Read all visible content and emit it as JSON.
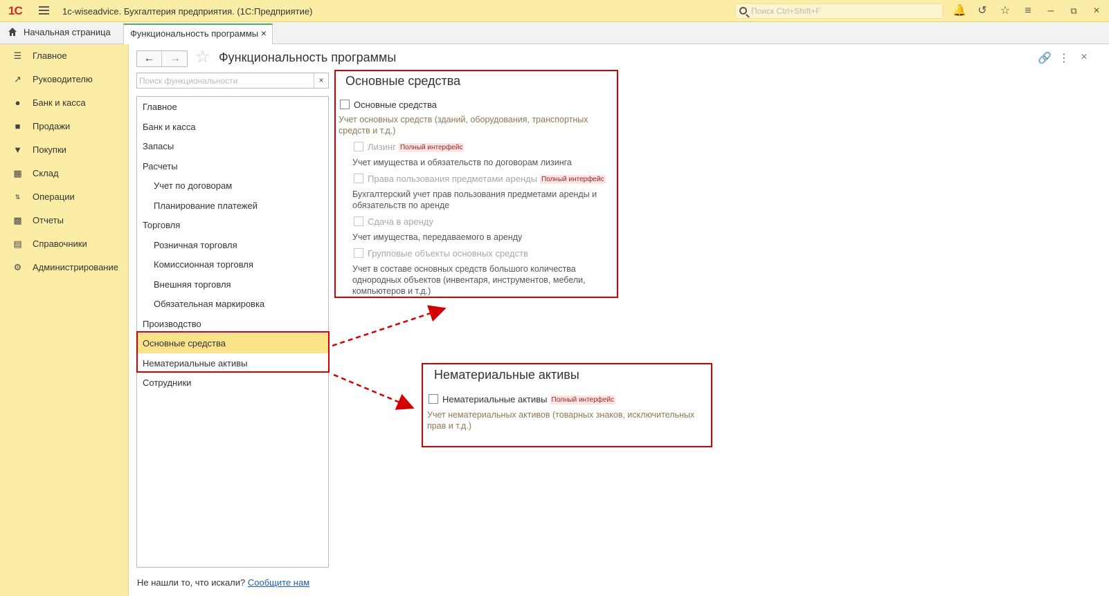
{
  "titlebar": {
    "app_title": "1c-wiseadvice. Бухгалтерия предприятия. (1С:Предприятие)",
    "search_placeholder": "Поиск Ctrl+Shift+F",
    "logo_text": "1С"
  },
  "tabs": {
    "home": "Начальная страница",
    "active": "Функциональность программы"
  },
  "sidebar": {
    "items": [
      {
        "label": "Главное",
        "icon": "list-icon"
      },
      {
        "label": "Руководителю",
        "icon": "trend-icon"
      },
      {
        "label": "Банк и касса",
        "icon": "coin-icon"
      },
      {
        "label": "Продажи",
        "icon": "bag-icon"
      },
      {
        "label": "Покупки",
        "icon": "cart-icon"
      },
      {
        "label": "Склад",
        "icon": "warehouse-icon"
      },
      {
        "label": "Операции",
        "icon": "operations-icon"
      },
      {
        "label": "Отчеты",
        "icon": "bar-chart-icon"
      },
      {
        "label": "Справочники",
        "icon": "book-icon"
      },
      {
        "label": "Администрирование",
        "icon": "gear-icon"
      }
    ]
  },
  "main": {
    "title": "Функциональность программы",
    "search_placeholder": "Поиск функциональности",
    "sections": [
      {
        "label": "Главное",
        "level": 0
      },
      {
        "label": "Банк и касса",
        "level": 0
      },
      {
        "label": "Запасы",
        "level": 0
      },
      {
        "label": "Расчеты",
        "level": 0
      },
      {
        "label": "Учет по договорам",
        "level": 1
      },
      {
        "label": "Планирование платежей",
        "level": 1
      },
      {
        "label": "Торговля",
        "level": 0
      },
      {
        "label": "Розничная торговля",
        "level": 1
      },
      {
        "label": "Комиссионная торговля",
        "level": 1
      },
      {
        "label": "Внешняя торговля",
        "level": 1
      },
      {
        "label": "Обязательная маркировка",
        "level": 1
      },
      {
        "label": "Производство",
        "level": 0
      },
      {
        "label": "Основные средства",
        "level": 0,
        "selected": true
      },
      {
        "label": "Нематериальные активы",
        "level": 0
      },
      {
        "label": "Сотрудники",
        "level": 0
      }
    ],
    "footer_text": "Не нашли то, что искали?",
    "footer_link": "Сообщите нам"
  },
  "fixed_assets_panel": {
    "title": "Основные средства",
    "main_checkbox": {
      "label": "Основные средства",
      "checked": false
    },
    "main_desc": "Учет основных средств (зданий, оборудования, транспортных средств и т.д.)",
    "options": [
      {
        "label": "Лизинг",
        "badge": "Полный интерфейс",
        "desc": "Учет имущества и обязательств  по договорам лизинга"
      },
      {
        "label": "Права пользования предметами аренды",
        "badge": "Полный интерфейс",
        "desc": "Бухгалтерский учет прав пользования предметами аренды и обязательств по аренде"
      },
      {
        "label": "Сдача в аренду",
        "badge": "",
        "desc": "Учет имущества, передаваемого в аренду"
      },
      {
        "label": "Групповые объекты основных средств",
        "badge": "",
        "desc": "Учет в составе основных средств большого количества однородных объектов (инвентаря, инструментов, мебели, компьютеров и т.д.)"
      }
    ]
  },
  "intangible_panel": {
    "title": "Нематериальные активы",
    "checkbox": {
      "label": "Нематериальные активы",
      "badge": "Полный интерфейс",
      "checked": false
    },
    "desc": "Учет нематериальных активов (товарных знаков, исключительных прав и т.д.)"
  },
  "colors": {
    "titlebar_bg": "#fbeda5",
    "sidebar_bg": "#fbeda5",
    "selected_row": "#fbe38a",
    "highlight_red": "#d40000",
    "link": "#1e5fa8",
    "tab_accent": "#4caf50"
  }
}
